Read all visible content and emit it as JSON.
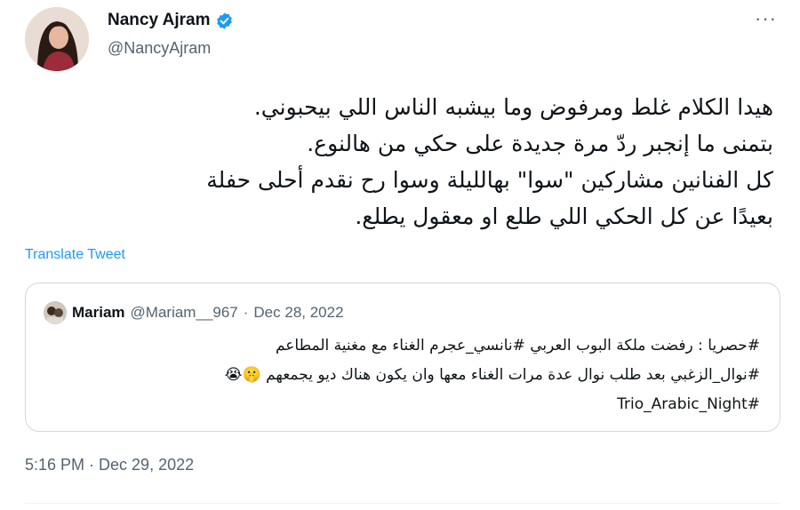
{
  "author": {
    "name": "Nancy Ajram",
    "handle": "@NancyAjram",
    "verified": true,
    "avatar_icon": "avatar-photo"
  },
  "more_label": "···",
  "tweet": {
    "lines": [
      "هيدا الكلام غلط ومرفوض وما بيشبه الناس اللي بيحبوني.",
      "بتمنى ما إنجبر ردّ مرة جديدة على حكي من هالنوع.",
      "كل الفنانين مشاركين \"سوا\" بهالليلة وسوا رح نقدم أحلى حفلة",
      "بعيدًا عن كل الحكي اللي طلع او معقول يطلع."
    ],
    "translate_label": "Translate Tweet"
  },
  "quote": {
    "name": "Mariam",
    "handle": "@Mariam__967",
    "separator": "·",
    "date": "Dec 28, 2022",
    "lines": [
      "#حصريا : رفضت ملكة البوب العربي #نانسي_عجرم الغناء مع مغنية المطاعم",
      "#نوال_الزغبي بعد طلب نوال عدة مرات الغناء معها وان يكون هناك ديو يجمعهم 🤫😭",
      "#Trio_Arabic_Night"
    ]
  },
  "timestamp": "5:16 PM · Dec 29, 2022",
  "colors": {
    "accent": "#1d9bf0",
    "text": "#0f1419",
    "secondary": "#536471",
    "border": "#cfd9de"
  }
}
